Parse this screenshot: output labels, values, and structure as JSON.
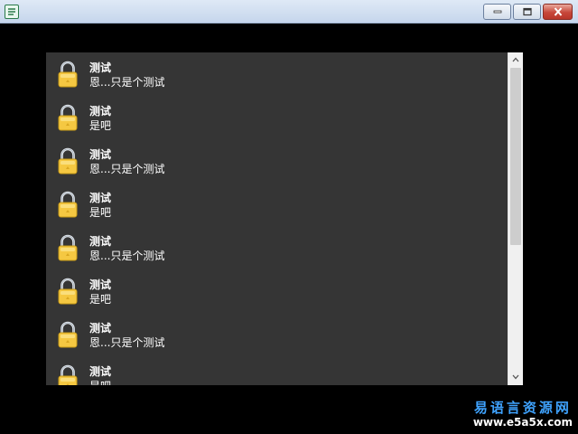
{
  "window": {
    "title": "",
    "controls": [
      "minimize-icon",
      "maximize-icon",
      "close-icon"
    ]
  },
  "list": {
    "items": [
      {
        "title": "测试",
        "subtitle": "恩...只是个测试",
        "icon": "lock-icon"
      },
      {
        "title": "测试",
        "subtitle": "是吧",
        "icon": "lock-icon"
      },
      {
        "title": "测试",
        "subtitle": "恩...只是个测试",
        "icon": "lock-icon"
      },
      {
        "title": "测试",
        "subtitle": "是吧",
        "icon": "lock-icon"
      },
      {
        "title": "测试",
        "subtitle": "恩...只是个测试",
        "icon": "lock-icon"
      },
      {
        "title": "测试",
        "subtitle": "是吧",
        "icon": "lock-icon"
      },
      {
        "title": "测试",
        "subtitle": "恩...只是个测试",
        "icon": "lock-icon"
      },
      {
        "title": "测试",
        "subtitle": "是吧",
        "icon": "lock-icon"
      }
    ]
  },
  "watermark": {
    "name": "易语言资源网",
    "url": "www.e5a5x.com"
  },
  "colors": {
    "list_background": "#353535",
    "text": "#ffffff",
    "lock_body": "#f5c842",
    "watermark": "#3fa3ff"
  }
}
